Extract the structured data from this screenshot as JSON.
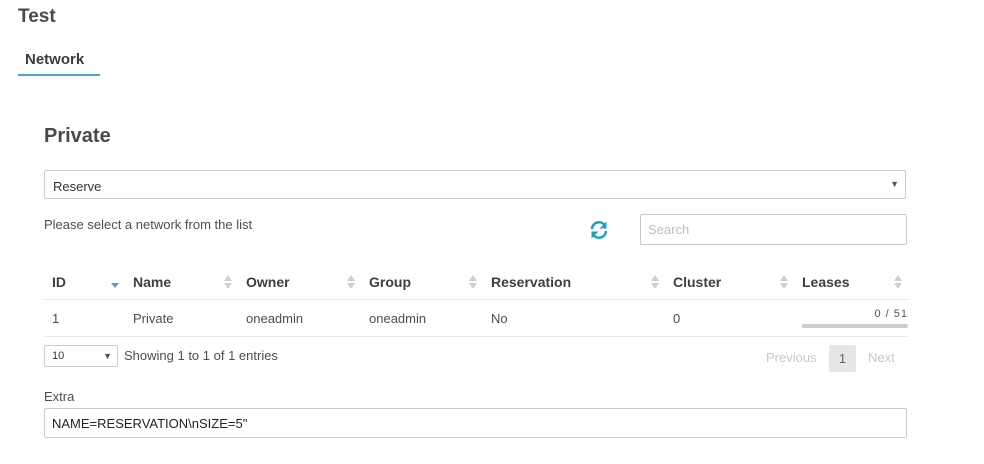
{
  "page": {
    "title": "Test"
  },
  "tabs": [
    {
      "label": "Network",
      "active": true
    }
  ],
  "section": {
    "title": "Private"
  },
  "action_select": {
    "value": "Reserve"
  },
  "hint": "Please select a network from the list",
  "search": {
    "placeholder": "Search",
    "value": ""
  },
  "table": {
    "columns": [
      "ID",
      "Name",
      "Owner",
      "Group",
      "Reservation",
      "Cluster",
      "Leases"
    ],
    "rows": [
      {
        "id": "1",
        "name": "Private",
        "owner": "oneadmin",
        "group": "oneadmin",
        "reservation": "No",
        "cluster": "0",
        "leases_text": "0 / 51",
        "leases_fraction": 0
      }
    ]
  },
  "pagination": {
    "length_value": "10",
    "info": "Showing 1 to 1 of 1 entries",
    "previous": "Previous",
    "current_page": "1",
    "next": "Next"
  },
  "extra": {
    "label": "Extra",
    "value": "NAME=RESERVATION\\nSIZE=5\""
  },
  "colors": {
    "accent": "#4aa8c8",
    "refresh_icon": "#1d9fc4"
  }
}
